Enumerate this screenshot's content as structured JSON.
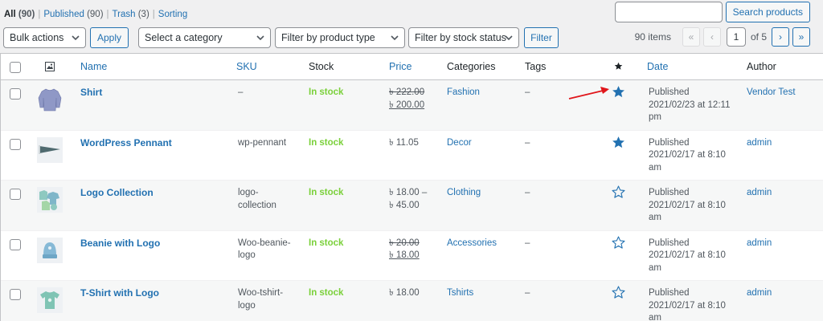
{
  "filters": {
    "all_label": "All",
    "all_count": "(90)",
    "published_label": "Published",
    "published_count": "(90)",
    "trash_label": "Trash",
    "trash_count": "(3)",
    "sorting_label": "Sorting",
    "separator": "|"
  },
  "search": {
    "input_value": "",
    "button_label": "Search products"
  },
  "toolbar": {
    "bulk_actions": "Bulk actions",
    "apply_label": "Apply",
    "category_select": "Select a category",
    "product_type_select": "Filter by product type",
    "stock_status_select": "Filter by stock status",
    "filter_label": "Filter"
  },
  "pagination": {
    "items_count": "90 items",
    "first": "«",
    "prev": "‹",
    "current_page": "1",
    "of_text": "of 5",
    "next": "›",
    "last": "»"
  },
  "columns": {
    "name": "Name",
    "sku": "SKU",
    "stock": "Stock",
    "price": "Price",
    "categories": "Categories",
    "tags": "Tags",
    "featured_icon": "star-icon",
    "date": "Date",
    "author": "Author"
  },
  "products": [
    {
      "name": "Shirt",
      "sku": "–",
      "stock": "In stock",
      "price_regular": "৳ 222.00",
      "price_sale": "৳ 200.00",
      "category": "Fashion",
      "tags": "–",
      "featured": true,
      "date_status": "Published",
      "date_line1": "2021/02/23 at 12:11",
      "date_line2": "pm",
      "author": "Vendor Test",
      "thumb": "shirt-thumbnail"
    },
    {
      "name": "WordPress Pennant",
      "sku": "wp-pennant",
      "stock": "In stock",
      "price": "৳ 11.05",
      "category": "Decor",
      "tags": "–",
      "featured": true,
      "date_status": "Published",
      "date_line1": "2021/02/17 at 8:10",
      "date_line2": "am",
      "author": "admin",
      "thumb": "pennant-thumbnail"
    },
    {
      "name": "Logo Collection",
      "sku_line1": "logo-",
      "sku_line2": "collection",
      "stock": "In stock",
      "price_line1": "৳ 18.00 –",
      "price_line2": "৳ 45.00",
      "category": "Clothing",
      "tags": "–",
      "featured": false,
      "date_status": "Published",
      "date_line1": "2021/02/17 at 8:10",
      "date_line2": "am",
      "author": "admin",
      "thumb": "logo-collection-thumbnail"
    },
    {
      "name": "Beanie with Logo",
      "sku_line1": "Woo-beanie-",
      "sku_line2": "logo",
      "stock": "In stock",
      "price_regular": "৳ 20.00",
      "price_sale": "৳ 18.00",
      "category": "Accessories",
      "tags": "–",
      "featured": false,
      "date_status": "Published",
      "date_line1": "2021/02/17 at 8:10",
      "date_line2": "am",
      "author": "admin",
      "thumb": "beanie-thumbnail"
    },
    {
      "name": "T-Shirt with Logo",
      "sku_line1": "Woo-tshirt-",
      "sku_line2": "logo",
      "stock": "In stock",
      "price": "৳ 18.00",
      "category": "Tshirts",
      "tags": "–",
      "featured": false,
      "date_status": "Published",
      "date_line1": "2021/02/17 at 8:10",
      "date_line2": "am",
      "author": "admin",
      "thumb": "tshirt-thumbnail"
    }
  ],
  "colors": {
    "link": "#2271b1",
    "in_stock": "#7ad03a",
    "featured_star": "#2271b1",
    "annotation_arrow": "#e0161b"
  }
}
